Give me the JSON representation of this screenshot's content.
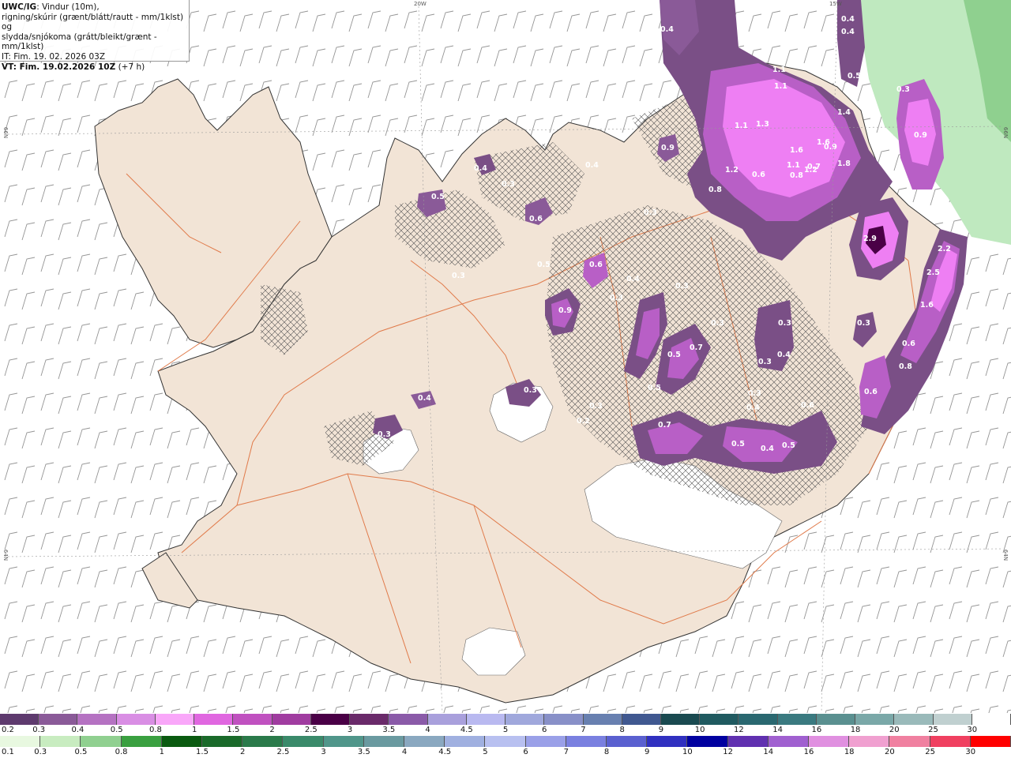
{
  "title_bold": "UWC/IG",
  "title_rest": ": Vindur (10m),",
  "line2": "rigning/skúrir (grænt/blátt/rautt - mm/1klst) og",
  "line3": "slydda/snjókoma (grátt/bleikt/grænt - mm/1klst)",
  "it_line": "IT: Fim. 19. 02. 2026 03Z",
  "vt_bold": "VT: Fim. 19.02.2026 10Z",
  "vt_rest": " (+7 h)",
  "axis": {
    "top_20w": "20W",
    "top_15w": "15W",
    "left_66n": "66N",
    "left_64n": "64N",
    "right_66n": "66N",
    "right_64n": "64N"
  },
  "colors": {
    "land": "#f2e4d6",
    "sea": "#ffffff",
    "roads": "#e07a4a",
    "precip_light": "#7a4f86",
    "precip_mid": "#b85fc6",
    "precip_strong": "#ee7ff3",
    "rain_green": "#b8e6b8"
  },
  "legend_top": {
    "labels": [
      "0.2",
      "0.3",
      "0.4",
      "0.5",
      "0.8",
      "1",
      "1.5",
      "2",
      "2.5",
      "3",
      "3.5",
      "4",
      "4.5",
      "5",
      "6",
      "7",
      "8",
      "9",
      "10",
      "12",
      "14",
      "16",
      "18",
      "20",
      "25",
      "30"
    ],
    "colors": [
      "#5e3a6e",
      "#8a5a98",
      "#b572c2",
      "#d98ee4",
      "#f9a7f9",
      "#e067e0",
      "#c051c0",
      "#a03ca0",
      "#4a0046",
      "#6a2a6a",
      "#8a5aa8",
      "#a9a0dc",
      "#b9b9f0",
      "#a0a8dc",
      "#8890c8",
      "#6880b0",
      "#405890",
      "#1a4a50",
      "#205a60",
      "#2a6870",
      "#3a7a80",
      "#5a9090",
      "#7aa8a8",
      "#9ababa",
      "#c0d0d0",
      "#ffffff"
    ]
  },
  "legend_bottom": {
    "labels": [
      "0.1",
      "0.3",
      "0.5",
      "0.8",
      "1",
      "1.5",
      "2",
      "2.5",
      "3",
      "3.5",
      "4",
      "4.5",
      "5",
      "6",
      "7",
      "8",
      "9",
      "10",
      "12",
      "14",
      "16",
      "18",
      "20",
      "25",
      "30"
    ],
    "colors": [
      "#e8f8e0",
      "#c8ecc0",
      "#90d090",
      "#3aa040",
      "#0a5a10",
      "#1a6a2a",
      "#2a7a4a",
      "#3a8a6a",
      "#50968a",
      "#6a9aa0",
      "#8aa8c0",
      "#a0b0e0",
      "#b8c0f0",
      "#9aa0e8",
      "#7a80e0",
      "#5a60d0",
      "#3030c0",
      "#0000a0",
      "#6030b0",
      "#a060d0",
      "#e090e0",
      "#f0a0d0",
      "#f080a0",
      "#f04060",
      "#ff0000"
    ]
  },
  "precip_values": [
    "0.4",
    "0.4",
    "0.4",
    "1.1",
    "1.1",
    "1.3",
    "1.2",
    "0.6",
    "1.6",
    "1.1",
    "1.2",
    "1.6",
    "1.8",
    "1.4",
    "0.8",
    "0.9",
    "0.9",
    "2.9",
    "2.2",
    "2.5",
    "1.6",
    "0.3",
    "0.3",
    "0.5",
    "0.6",
    "0.4",
    "0.9",
    "0.6",
    "0.4",
    "0.3",
    "0.5",
    "0.7",
    "0.3",
    "0.5",
    "0.4",
    "0.3",
    "0.3",
    "0.3",
    "0.7",
    "0.6",
    "0.4",
    "0.5",
    "0.5",
    "0.3",
    "0.3",
    "0.6",
    "0.8",
    "0.6",
    "0.7",
    "0.4",
    "0.3",
    "0.4",
    "0.3",
    "0.3",
    "0.2",
    "0.3",
    "0.5",
    "0.8",
    "0.9",
    "0.4",
    "0.3",
    "1.1",
    "0.5",
    "0.3"
  ]
}
